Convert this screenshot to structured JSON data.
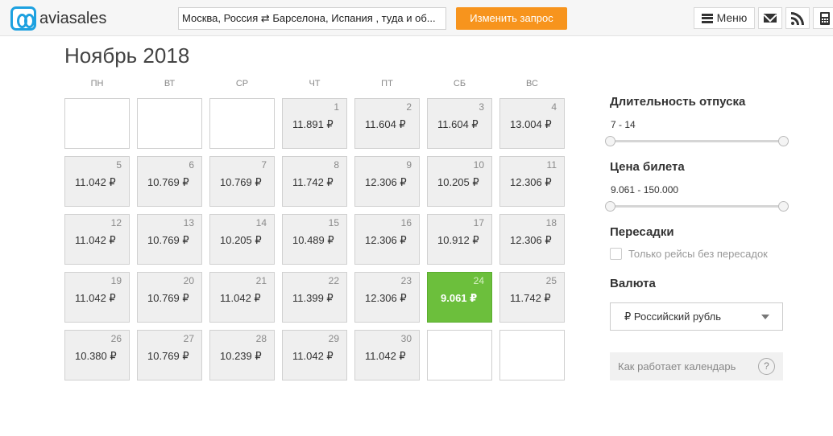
{
  "header": {
    "logo_text": "aviasales",
    "route_text": "Москва, Россия  ⇄ Барселона, Испания , туда и об...",
    "search_button": "Изменить запрос",
    "menu_label": "Меню",
    "icons": [
      "menu-icon",
      "mail-icon",
      "rss-icon",
      "calculator-icon"
    ]
  },
  "calendar": {
    "title": "Ноябрь 2018",
    "weekdays": [
      "ПН",
      "ВТ",
      "СР",
      "ЧТ",
      "ПТ",
      "СБ",
      "ВС"
    ],
    "days": [
      {
        "day": "1",
        "price": "11.891 ₽"
      },
      {
        "day": "2",
        "price": "11.604 ₽"
      },
      {
        "day": "3",
        "price": "11.604 ₽"
      },
      {
        "day": "4",
        "price": "13.004 ₽"
      },
      {
        "day": "5",
        "price": "11.042 ₽"
      },
      {
        "day": "6",
        "price": "10.769 ₽"
      },
      {
        "day": "7",
        "price": "10.769 ₽"
      },
      {
        "day": "8",
        "price": "11.742 ₽"
      },
      {
        "day": "9",
        "price": "12.306 ₽"
      },
      {
        "day": "10",
        "price": "10.205 ₽"
      },
      {
        "day": "11",
        "price": "12.306 ₽"
      },
      {
        "day": "12",
        "price": "11.042 ₽"
      },
      {
        "day": "13",
        "price": "10.769 ₽"
      },
      {
        "day": "14",
        "price": "10.205 ₽"
      },
      {
        "day": "15",
        "price": "10.489 ₽"
      },
      {
        "day": "16",
        "price": "12.306 ₽"
      },
      {
        "day": "17",
        "price": "10.912 ₽"
      },
      {
        "day": "18",
        "price": "12.306 ₽"
      },
      {
        "day": "19",
        "price": "11.042 ₽"
      },
      {
        "day": "20",
        "price": "10.769 ₽"
      },
      {
        "day": "21",
        "price": "11.042 ₽"
      },
      {
        "day": "22",
        "price": "11.399 ₽"
      },
      {
        "day": "23",
        "price": "12.306 ₽"
      },
      {
        "day": "24",
        "price": "9.061 ₽",
        "best": true
      },
      {
        "day": "25",
        "price": "11.742 ₽"
      },
      {
        "day": "26",
        "price": "10.380 ₽"
      },
      {
        "day": "27",
        "price": "10.769 ₽"
      },
      {
        "day": "28",
        "price": "10.239 ₽"
      },
      {
        "day": "29",
        "price": "11.042 ₽"
      },
      {
        "day": "30",
        "price": "11.042 ₽"
      }
    ],
    "best_color": "#6cbf3c"
  },
  "filters": {
    "duration_title": "Длительность отпуска",
    "duration_value": "7 - 14",
    "price_title": "Цена билета",
    "price_value": "9.061 - 150.000",
    "transfers_title": "Пересадки",
    "direct_only_label": "Только рейсы без пересадок",
    "currency_title": "Валюта",
    "currency_selected": "₽ Российский рубль",
    "how_it_works": "Как работает календарь",
    "help_symbol": "?"
  },
  "colors": {
    "accent": "#f7941d",
    "logo": "#1da1e0"
  }
}
